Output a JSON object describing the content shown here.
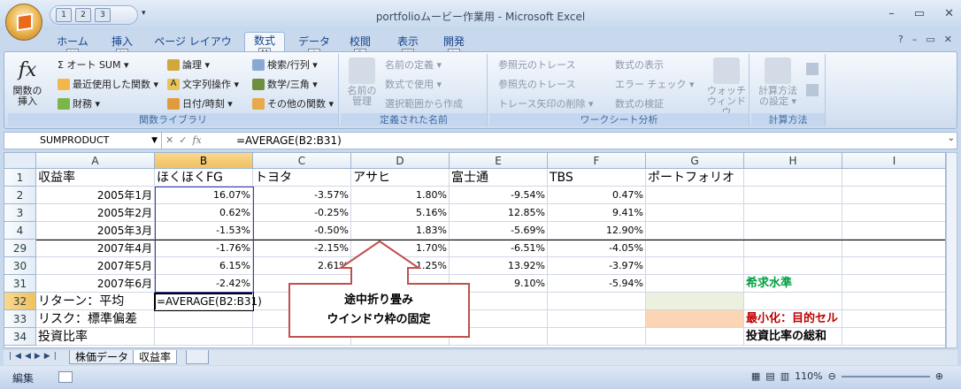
{
  "window": {
    "title": "portfolioムービー作業用 - Microsoft Excel",
    "qat_keys": [
      "1",
      "2",
      "3"
    ]
  },
  "ribbon": {
    "tabs": [
      {
        "label": "ホーム",
        "key": "H"
      },
      {
        "label": "挿入",
        "key": "N"
      },
      {
        "label": "ページ レイアウト",
        "key": "P"
      },
      {
        "label": "数式",
        "key": "M"
      },
      {
        "label": "データ",
        "key": "A"
      },
      {
        "label": "校閲",
        "key": "R"
      },
      {
        "label": "表示",
        "key": "W"
      },
      {
        "label": "開発",
        "key": "L"
      }
    ],
    "groups": {
      "function_library": {
        "label": "関数ライブラリ",
        "insert_function": "関数の挿入",
        "autosum": "Σ オート SUM ▾",
        "recent": "最近使用した関数 ▾",
        "financial": "財務 ▾",
        "logical": "論理 ▾",
        "text": "文字列操作 ▾",
        "datetime": "日付/時刻 ▾",
        "lookup": "検索/行列 ▾",
        "math": "数学/三角 ▾",
        "more": "その他の関数 ▾"
      },
      "defined_names": {
        "label": "定義された名前",
        "name_manager": "名前の管理",
        "define_name": "名前の定義 ▾",
        "use_in_formula": "数式で使用 ▾",
        "create_from_selection": "選択範囲から作成"
      },
      "formula_auditing": {
        "label": "ワークシート分析",
        "trace_precedents": "参照元のトレース",
        "trace_dependents": "参照先のトレース",
        "remove_arrows": "トレース矢印の削除 ▾",
        "show_formulas": "数式の表示",
        "error_checking": "エラー チェック ▾",
        "evaluate_formula": "数式の検証",
        "watch_window": "ウォッチ ウィンドウ"
      },
      "calculation": {
        "label": "計算方法",
        "calc_options": "計算方法の設定 ▾"
      }
    }
  },
  "formula_bar": {
    "name_box": "SUMPRODUCT",
    "formula": "=AVERAGE(B2:B31)",
    "fx": "fx"
  },
  "sheet": {
    "columns": [
      "A",
      "B",
      "C",
      "D",
      "E",
      "F",
      "G",
      "H",
      "I"
    ],
    "rows": [
      {
        "num": "1",
        "cells": [
          "収益率",
          "ほくほくFG",
          "トヨタ",
          "アサヒ",
          "富士通",
          "TBS",
          "ポートフォリオ",
          "",
          ""
        ]
      },
      {
        "num": "2",
        "cells": [
          "2005年1月",
          "16.07%",
          "-3.57%",
          "1.80%",
          "-9.54%",
          "0.47%",
          "",
          "",
          ""
        ]
      },
      {
        "num": "3",
        "cells": [
          "2005年2月",
          "0.62%",
          "-0.25%",
          "5.16%",
          "12.85%",
          "9.41%",
          "",
          "",
          ""
        ]
      },
      {
        "num": "4",
        "cells": [
          "2005年3月",
          "-1.53%",
          "-0.50%",
          "1.83%",
          "-5.69%",
          "12.90%",
          "",
          "",
          ""
        ]
      },
      {
        "num": "29",
        "cells": [
          "2007年4月",
          "-1.76%",
          "-2.15%",
          "1.70%",
          "-6.51%",
          "-4.05%",
          "",
          "",
          ""
        ]
      },
      {
        "num": "30",
        "cells": [
          "2007年5月",
          "6.15%",
          "2.61%",
          "1.25%",
          "13.92%",
          "-3.97%",
          "",
          "",
          ""
        ]
      },
      {
        "num": "31",
        "cells": [
          "2007年6月",
          "-2.42%",
          "",
          "",
          "9.10%",
          "-5.94%",
          "",
          "希求水準",
          ""
        ]
      },
      {
        "num": "32",
        "cells": [
          "リターン：平均",
          "=AVERAGE(B2:B31)",
          "",
          "",
          "",
          "",
          "",
          "",
          ""
        ]
      },
      {
        "num": "33",
        "cells": [
          "リスク：標準偏差",
          "",
          "",
          "",
          "",
          "",
          "",
          "最小化：目的セル",
          ""
        ]
      },
      {
        "num": "34",
        "cells": [
          "投資比率",
          "",
          "",
          "",
          "",
          "",
          "",
          "投資比率の総和",
          ""
        ]
      }
    ]
  },
  "callout": {
    "line1": "途中折り畳み",
    "line2": "ウインドウ枠の固定"
  },
  "sheet_tabs": [
    "株価データ",
    "収益率"
  ],
  "status": {
    "mode": "編集",
    "zoom": "110%"
  },
  "colors": {
    "green_text": "#00a040",
    "red_text": "#c00000",
    "g32_fill": "#ebf1de",
    "g33_fill": "#fcd5b4",
    "callout_border": "#c0504d"
  }
}
